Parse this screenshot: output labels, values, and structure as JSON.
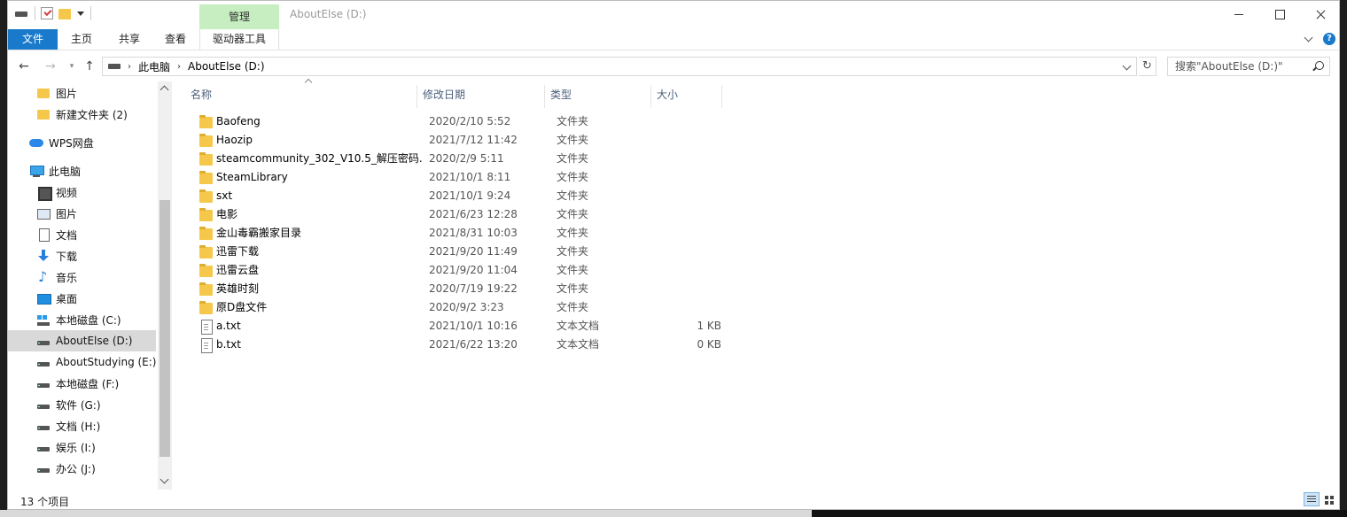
{
  "window": {
    "title": "AboutElse (D:)",
    "manage_label": "管理"
  },
  "ribbon": {
    "tabs": [
      {
        "label": "文件"
      },
      {
        "label": "主页"
      },
      {
        "label": "共享"
      },
      {
        "label": "查看"
      },
      {
        "label": "驱动器工具"
      }
    ]
  },
  "address": {
    "crumbs": [
      "此电脑",
      "AboutElse (D:)"
    ],
    "search_placeholder": "搜索\"AboutElse (D:)\""
  },
  "sidebar": {
    "items": [
      {
        "label": "图片",
        "icon": "folder-icon"
      },
      {
        "label": "新建文件夹 (2)",
        "icon": "folder-icon"
      },
      {
        "label": "WPS网盘",
        "icon": "cloud-icon"
      },
      {
        "label": "此电脑",
        "icon": "computer-icon"
      },
      {
        "label": "视频",
        "icon": "video-icon"
      },
      {
        "label": "图片",
        "icon": "picture-icon"
      },
      {
        "label": "文档",
        "icon": "document-icon"
      },
      {
        "label": "下载",
        "icon": "download-icon"
      },
      {
        "label": "音乐",
        "icon": "music-icon"
      },
      {
        "label": "桌面",
        "icon": "desktop-icon"
      },
      {
        "label": "本地磁盘 (C:)",
        "icon": "system-drive-icon"
      },
      {
        "label": "AboutElse (D:)",
        "icon": "drive-icon",
        "selected": true
      },
      {
        "label": "AboutStudying (E:)",
        "icon": "drive-icon"
      },
      {
        "label": "本地磁盘 (F:)",
        "icon": "drive-icon"
      },
      {
        "label": "软件 (G:)",
        "icon": "drive-icon"
      },
      {
        "label": "文档 (H:)",
        "icon": "drive-icon"
      },
      {
        "label": "娱乐 (I:)",
        "icon": "drive-icon"
      },
      {
        "label": "办公 (J:)",
        "icon": "drive-icon"
      }
    ]
  },
  "filelist": {
    "columns": {
      "name": "名称",
      "date": "修改日期",
      "type": "类型",
      "size": "大小"
    },
    "rows": [
      {
        "name": "Baofeng",
        "date": "2020/2/10 5:52",
        "type": "文件夹",
        "size": "",
        "icon": "folder-icon"
      },
      {
        "name": "Haozip",
        "date": "2021/7/12 11:42",
        "type": "文件夹",
        "size": "",
        "icon": "folder-icon"
      },
      {
        "name": "steamcommunity_302_V10.5_解压密码...",
        "date": "2020/2/9 5:11",
        "type": "文件夹",
        "size": "",
        "icon": "folder-icon"
      },
      {
        "name": "SteamLibrary",
        "date": "2021/10/1 8:11",
        "type": "文件夹",
        "size": "",
        "icon": "folder-icon"
      },
      {
        "name": "sxt",
        "date": "2021/10/1 9:24",
        "type": "文件夹",
        "size": "",
        "icon": "folder-icon"
      },
      {
        "name": "电影",
        "date": "2021/6/23 12:28",
        "type": "文件夹",
        "size": "",
        "icon": "folder-icon"
      },
      {
        "name": "金山毒霸搬家目录",
        "date": "2021/8/31 10:03",
        "type": "文件夹",
        "size": "",
        "icon": "folder-icon"
      },
      {
        "name": "迅雷下载",
        "date": "2021/9/20 11:49",
        "type": "文件夹",
        "size": "",
        "icon": "folder-icon"
      },
      {
        "name": "迅雷云盘",
        "date": "2021/9/20 11:04",
        "type": "文件夹",
        "size": "",
        "icon": "folder-icon"
      },
      {
        "name": "英雄时刻",
        "date": "2020/7/19 19:22",
        "type": "文件夹",
        "size": "",
        "icon": "folder-icon"
      },
      {
        "name": "原D盘文件",
        "date": "2020/9/2 3:23",
        "type": "文件夹",
        "size": "",
        "icon": "folder-icon"
      },
      {
        "name": "a.txt",
        "date": "2021/10/1 10:16",
        "type": "文本文档",
        "size": "1 KB",
        "icon": "text-file-icon"
      },
      {
        "name": "b.txt",
        "date": "2021/6/22 13:20",
        "type": "文本文档",
        "size": "0 KB",
        "icon": "text-file-icon"
      }
    ]
  },
  "status": {
    "item_count": "13 个项目"
  }
}
